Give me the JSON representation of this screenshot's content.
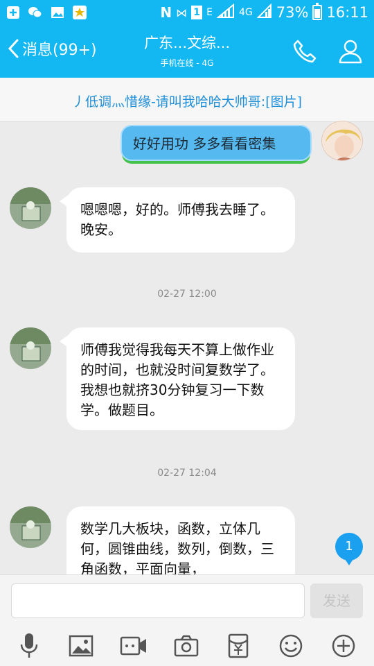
{
  "status": {
    "network": "4G",
    "battery": "73%",
    "time": "16:11",
    "sim": "1",
    "signal_letter": "E"
  },
  "header": {
    "back_label": "消息(99+)",
    "title": "广东...文综...",
    "subtitle": "手机在线 - 4G"
  },
  "banner": {
    "text": "丿低调灬惜缘-请叫我哈哈大帅哥:[图片]"
  },
  "messages": [
    {
      "text": "好好用功 多多看看密集"
    },
    {
      "text": "嗯嗯嗯，好的。师傅我去睡了。晚安。"
    },
    {
      "timestamp": "02-27 12:00"
    },
    {
      "text": "师傅我觉得我每天不算上做作业的时间，也就没时间复数学了。我想也就挤30分钟复习一下数学。做题目。"
    },
    {
      "timestamp": "02-27 12:04"
    },
    {
      "text": "数学几大板块，函数，立体几何，圆锥曲线，数列，倒数，三角函数，平面向量，"
    }
  ],
  "unread_count": "1",
  "input": {
    "placeholder": "",
    "send_label": "发送"
  },
  "colors": {
    "accent": "#13b7f2",
    "link": "#1f8fd9"
  }
}
